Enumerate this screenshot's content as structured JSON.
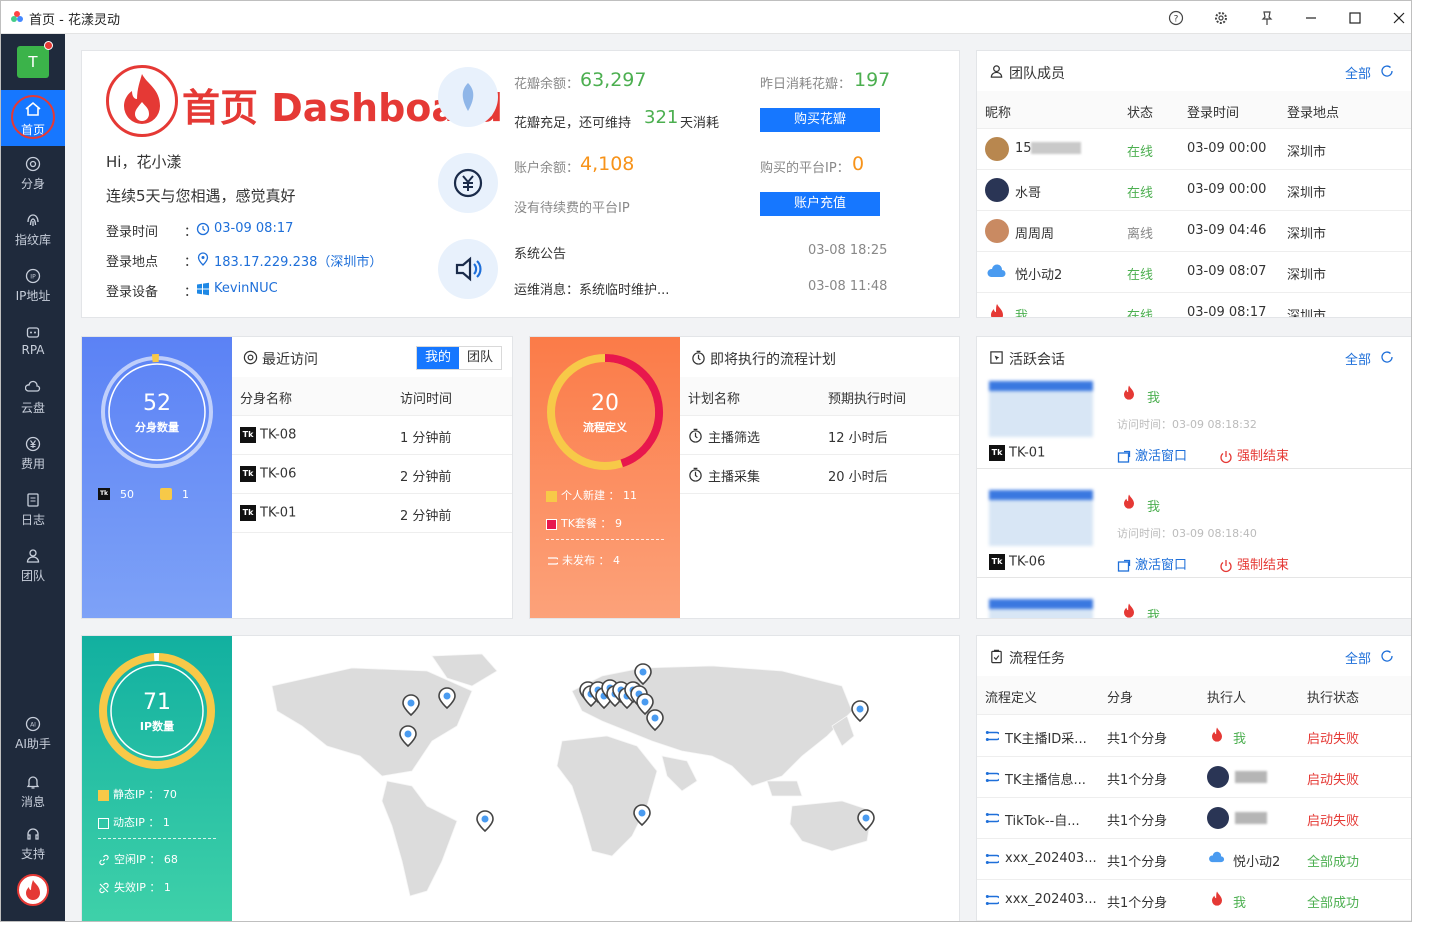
{
  "app": {
    "title": "首页 - 花漾灵动"
  },
  "sidebar": {
    "avatar_letter": "T",
    "items": [
      {
        "label": "首页",
        "icon": "home-icon"
      },
      {
        "label": "分身",
        "icon": "chrome-icon"
      },
      {
        "label": "指纹库",
        "icon": "fingerprint-icon"
      },
      {
        "label": "IP地址",
        "icon": "ip-icon"
      },
      {
        "label": "RPA",
        "icon": "robot-icon"
      },
      {
        "label": "云盘",
        "icon": "cloud-disk-icon"
      },
      {
        "label": "费用",
        "icon": "yen-icon"
      },
      {
        "label": "日志",
        "icon": "log-icon"
      },
      {
        "label": "团队",
        "icon": "team-icon"
      }
    ],
    "bottom": [
      {
        "label": "AI助手",
        "icon": "ai-icon"
      },
      {
        "label": "消息",
        "icon": "bell-icon"
      },
      {
        "label": "支持",
        "icon": "headset-icon"
      }
    ]
  },
  "dashboard": {
    "heading": "首页 Dashboard",
    "greeting": "Hi，花小漾",
    "welcome": "连续5天与您相遇，感觉真好",
    "login_time_label": "登录时间",
    "login_time": "03-09 08:17",
    "login_place_label": "登录地点",
    "login_place": "183.17.229.238（深圳市）",
    "login_device_label": "登录设备",
    "login_device": "KevinNUC",
    "colon": "：",
    "petal_balance_label": "花瓣余额：",
    "petal_balance": "63,297",
    "yesterday_label": "昨日消耗花瓣：",
    "yesterday_value": "197",
    "petal_enough_prefix": "花瓣充足，还可维持",
    "petal_days": "321",
    "petal_enough_suffix": "天消耗",
    "buy_petal": "购买花瓣",
    "account_balance_label": "账户余额：",
    "account_balance": "4,108",
    "platform_ip_label": "购买的平台IP：",
    "platform_ip_value": "0",
    "no_renew": "没有待续费的平台IP",
    "recharge": "账户充值",
    "notice1": "系统公告",
    "notice1_time": "03-08 18:25",
    "notice2": "运维消息：系统临时维护...",
    "notice2_time": "03-08 11:48"
  },
  "team": {
    "title": "团队成员",
    "all": "全部",
    "headers": [
      "昵称",
      "状态",
      "登录时间",
      "登录地点"
    ],
    "rows": [
      {
        "name": "15",
        "status": "在线",
        "time": "03-09 00:00",
        "place": "深圳市"
      },
      {
        "name": "水哥",
        "status": "在线",
        "time": "03-09 00:00",
        "place": "深圳市"
      },
      {
        "name": "周周周",
        "status": "离线",
        "time": "03-09 04:46",
        "place": "深圳市"
      },
      {
        "name": "悦小动2",
        "status": "在线",
        "time": "03-09 08:07",
        "place": "深圳市"
      },
      {
        "name": "我",
        "status": "在线",
        "time": "03-09 08:17",
        "place": "深圳市"
      }
    ]
  },
  "profiles": {
    "donut_value": "52",
    "donut_label": "分身数量",
    "tk_count": "50",
    "other_count": "1",
    "title": "最近访问",
    "tab_mine": "我的",
    "tab_team": "团队",
    "headers": [
      "分身名称",
      "访问时间"
    ],
    "rows": [
      {
        "name": "TK-08",
        "time": "1 分钟前"
      },
      {
        "name": "TK-06",
        "time": "2 分钟前"
      },
      {
        "name": "TK-01",
        "time": "2 分钟前"
      }
    ]
  },
  "flows": {
    "donut_value": "20",
    "donut_label": "流程定义",
    "legend": [
      {
        "label": "个人新建",
        "value": "11",
        "color": "#f7c948"
      },
      {
        "label": "TK套餐",
        "value": "9",
        "color": "#e8174d"
      },
      {
        "label": "未发布",
        "value": "4",
        "color": "#ffffff"
      }
    ],
    "title": "即将执行的流程计划",
    "headers": [
      "计划名称",
      "预期执行时间"
    ],
    "rows": [
      {
        "name": "主播筛选",
        "time": "12 小时后"
      },
      {
        "name": "主播采集",
        "time": "20 小时后"
      }
    ]
  },
  "sessions": {
    "title": "活跃会话",
    "all": "全部",
    "visit_label": "访问时间：",
    "activate": "激活窗口",
    "force_end": "强制结束",
    "items": [
      {
        "user": "我",
        "time": "03-09 08:18:32",
        "profile": "TK-01"
      },
      {
        "user": "我",
        "time": "03-09 08:18:40",
        "profile": "TK-06"
      },
      {
        "user": "我",
        "time": "",
        "profile": ""
      }
    ]
  },
  "ips": {
    "donut_value": "71",
    "donut_label": "IP数量",
    "static_label": "静态IP",
    "static_value": "70",
    "dynamic_label": "动态IP",
    "dynamic_value": "1",
    "idle_label": "空闲IP",
    "idle_value": "68",
    "invalid_label": "失效IP",
    "invalid_value": "1"
  },
  "tasks": {
    "title": "流程任务",
    "all": "全部",
    "headers": [
      "流程定义",
      "分身",
      "执行人",
      "执行状态"
    ],
    "rows": [
      {
        "name": "TK主播ID采...",
        "profile": "共1个分身",
        "user": "我",
        "status": "启动失败"
      },
      {
        "name": "TK主播信息...",
        "profile": "共1个分身",
        "user": "",
        "status": "启动失败"
      },
      {
        "name": "TikTok--自...",
        "profile": "共1个分身",
        "user": "",
        "status": "启动失败"
      },
      {
        "name": "xxx_202403...",
        "profile": "共1个分身",
        "user": "悦小动2",
        "status": "全部成功"
      },
      {
        "name": "xxx_202403...",
        "profile": "共1个分身",
        "user": "我",
        "status": "全部成功"
      }
    ]
  },
  "colors": {
    "accent": "#1677ff",
    "sidebar": "#1f2a3c",
    "online": "#4caf50",
    "fail": "#e53935",
    "profile_card": "#5b82f5",
    "flow_card": "#fb8a58",
    "ip_card": "#23b8a4"
  }
}
